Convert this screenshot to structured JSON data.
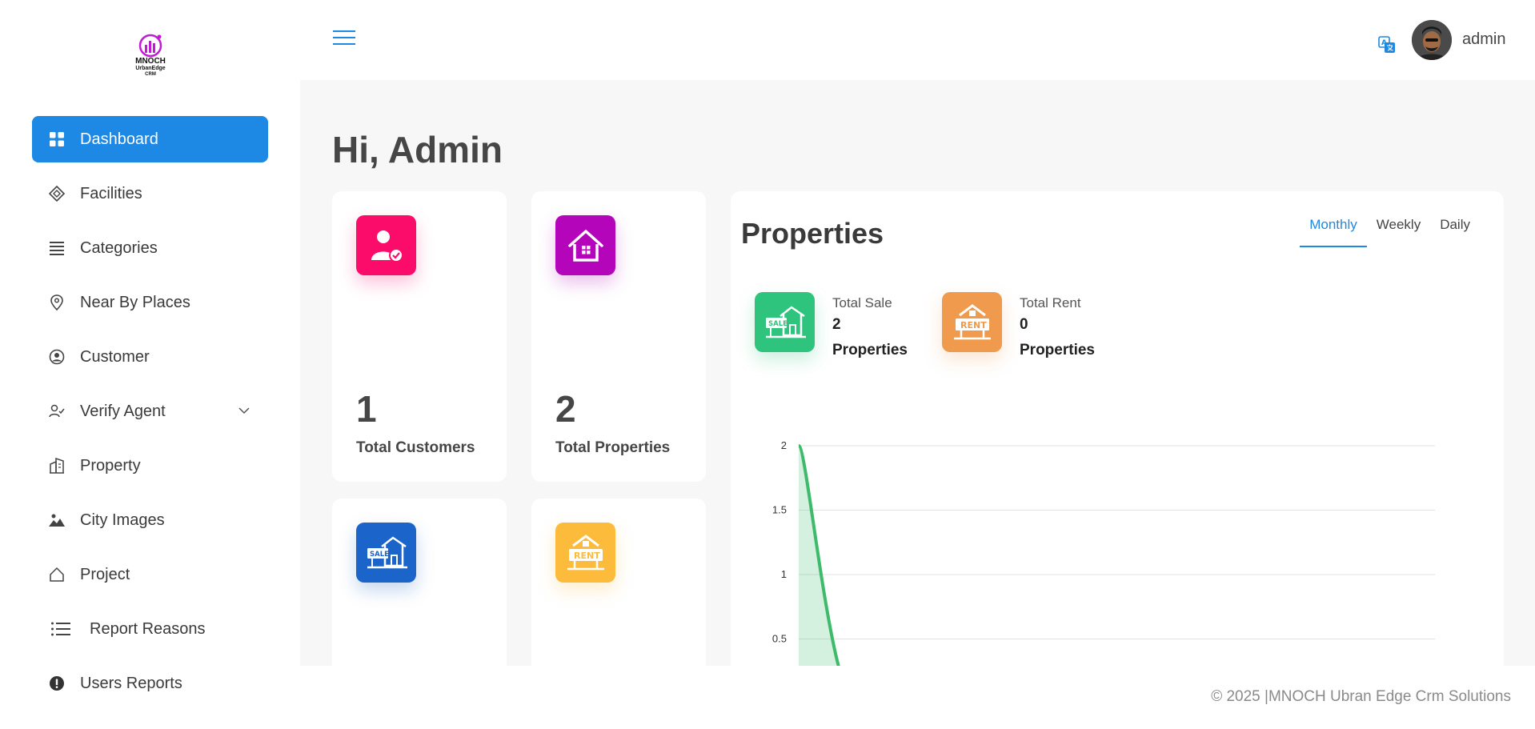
{
  "logo": {
    "line1": "MNOCH",
    "line2": "UrbanEdge",
    "line3": "CRM"
  },
  "sidebar": {
    "items": [
      {
        "label": "Dashboard",
        "icon": "grid-icon",
        "active": true
      },
      {
        "label": "Facilities",
        "icon": "diamond-icon"
      },
      {
        "label": "Categories",
        "icon": "lines-icon"
      },
      {
        "label": "Near By Places",
        "icon": "map-pin-icon"
      },
      {
        "label": "Customer",
        "icon": "user-circle-icon"
      },
      {
        "label": "Verify Agent",
        "icon": "user-check-icon",
        "has_submenu": true
      },
      {
        "label": "Property",
        "icon": "building-icon"
      },
      {
        "label": "City Images",
        "icon": "image-icon"
      },
      {
        "label": "Project",
        "icon": "home-outline-icon"
      },
      {
        "label": "Report Reasons",
        "icon": "list-icon"
      },
      {
        "label": "Users Reports",
        "icon": "alert-icon"
      }
    ]
  },
  "header": {
    "username": "admin"
  },
  "main": {
    "greeting": "Hi, Admin",
    "cards": [
      {
        "count": "1",
        "label": "Total Customers",
        "color": "#fb0c6a"
      },
      {
        "count": "2",
        "label": "Total Properties",
        "color": "#b505ba"
      },
      {
        "count": "",
        "label": "",
        "color": "#1b64c9"
      },
      {
        "count": "",
        "label": "",
        "color": "#fdbb3b"
      }
    ]
  },
  "properties": {
    "title": "Properties",
    "tabs": [
      "Monthly",
      "Weekly",
      "Daily"
    ],
    "active_tab": "Monthly",
    "sale": {
      "title": "Total Sale",
      "value": "2",
      "unit": "Properties",
      "color": "#2ec47e"
    },
    "rent": {
      "title": "Total Rent",
      "value": "0",
      "unit": "Properties",
      "color": "#f09a4d"
    }
  },
  "chart_data": {
    "type": "area",
    "y_ticks": [
      "2",
      "1.5",
      "1",
      "0.5"
    ],
    "ylim": [
      0,
      2
    ],
    "series": [
      {
        "values": [
          2,
          0,
          0,
          0,
          0,
          0,
          0,
          0,
          0,
          0,
          0,
          0
        ],
        "color": "#3dbb6a"
      }
    ]
  },
  "footer": {
    "text": "© 2025 |MNOCH Ubran Edge Crm Solutions"
  }
}
